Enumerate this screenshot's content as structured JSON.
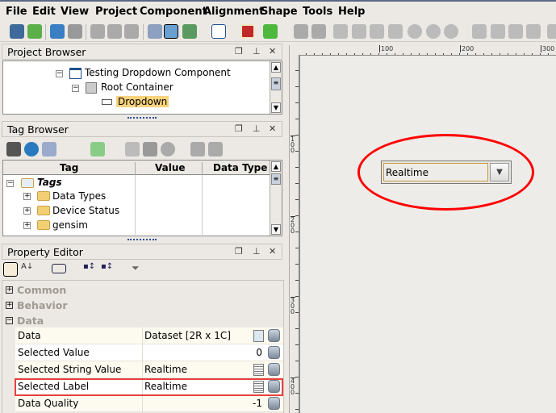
{
  "menu": [
    "File",
    "Edit",
    "View",
    "Project",
    "Component",
    "Alignment",
    "Shape",
    "Tools",
    "Help"
  ],
  "project_browser": {
    "title": "Project Browser",
    "items": [
      "Testing Dropdown Component",
      "Root Container",
      "Dropdown"
    ]
  },
  "tag_browser": {
    "title": "Tag Browser",
    "columns": [
      "Tag",
      "Value",
      "Data Type"
    ],
    "root": "Tags",
    "items": [
      "Data Types",
      "Device Status",
      "gensim"
    ]
  },
  "property_editor": {
    "title": "Property Editor",
    "categories": [
      "Common",
      "Behavior",
      "Data"
    ],
    "rows": [
      {
        "name": "Data",
        "value": "Dataset [2R x 1C]",
        "align": "left"
      },
      {
        "name": "Selected Value",
        "value": "0",
        "align": "right"
      },
      {
        "name": "Selected String Value",
        "value": "Realtime",
        "align": "left"
      },
      {
        "name": "Selected Label",
        "value": "Realtime",
        "align": "left"
      },
      {
        "name": "Data Quality",
        "value": "-1",
        "align": "right"
      }
    ]
  },
  "designer": {
    "ruler_top": [
      "100",
      "200",
      "300"
    ],
    "ruler_left": [
      "100",
      "200",
      "300",
      "400"
    ],
    "dropdown_value": "Realtime"
  },
  "colors": {
    "highlight": "#e8403c",
    "annotation": "#ff0000",
    "selection": "#f8d27c"
  }
}
